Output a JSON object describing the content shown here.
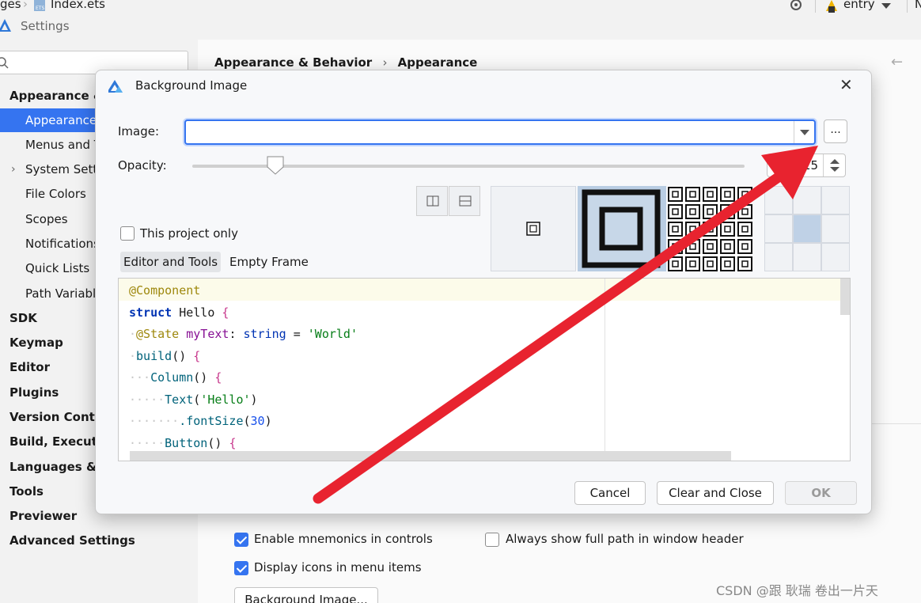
{
  "topbar": {
    "breadcrumb_left": "ges",
    "file_name": "Index.ets",
    "run_config": "entry",
    "overflow_char": "N"
  },
  "window": {
    "title": "Settings"
  },
  "sidebar": {
    "search_placeholder": "",
    "items": [
      {
        "label": "Appearance & Behavior",
        "level": 0
      },
      {
        "label": "Appearance",
        "level": 1,
        "selected": true
      },
      {
        "label": "Menus and Toolbars",
        "level": 1
      },
      {
        "label": "System Settings",
        "level": 1,
        "expandable": true
      },
      {
        "label": "File Colors",
        "level": 1
      },
      {
        "label": "Scopes",
        "level": 1
      },
      {
        "label": "Notifications",
        "level": 1
      },
      {
        "label": "Quick Lists",
        "level": 1
      },
      {
        "label": "Path Variables",
        "level": 1
      },
      {
        "label": "SDK",
        "level": 0
      },
      {
        "label": "Keymap",
        "level": 0
      },
      {
        "label": "Editor",
        "level": 0
      },
      {
        "label": "Plugins",
        "level": 0
      },
      {
        "label": "Version Control",
        "level": 0
      },
      {
        "label": "Build, Execution, Deployment",
        "level": 0
      },
      {
        "label": "Languages & Frameworks",
        "level": 0
      },
      {
        "label": "Tools",
        "level": 0
      },
      {
        "label": "Previewer",
        "level": 0
      },
      {
        "label": "Advanced Settings",
        "level": 0
      }
    ]
  },
  "content": {
    "breadcrumb_parent": "Appearance & Behavior",
    "breadcrumb_sep": "›",
    "breadcrumb_current": "Appearance",
    "options": [
      {
        "label": "Enable mnemonics in controls",
        "checked": true
      },
      {
        "label": "Display icons in menu items",
        "checked": true
      },
      {
        "label": "Always show full path in window header",
        "checked": false
      }
    ],
    "background_image_button": "Background Image..."
  },
  "dialog": {
    "title": "Background Image",
    "close_glyph": "✕",
    "image_label": "Image:",
    "image_value": "",
    "browse_label": "...",
    "opacity_label": "Opacity:",
    "opacity_value": 15,
    "opacity_display": "15",
    "this_project_only_label": "This project only",
    "this_project_only_checked": false,
    "tabs": [
      "Editor and Tools",
      "Empty Frame"
    ],
    "active_tab": "Editor and Tools",
    "fill_modes": [
      "plain",
      "scale",
      "tile"
    ],
    "selected_fill_mode": "scale",
    "anchor_selected": "center",
    "code_lines": [
      [
        {
          "t": "@Component",
          "c": "c-ann"
        }
      ],
      [
        {
          "t": "struct",
          "c": "c-kw"
        },
        {
          "t": " Hello ",
          "c": "c-plain"
        },
        {
          "t": "{",
          "c": "c-brace"
        }
      ],
      [
        {
          "t": "·",
          "c": "c-ws"
        },
        {
          "t": "@State",
          "c": "c-ann"
        },
        {
          "t": " myText",
          "c": "c-kw2"
        },
        {
          "t": ": ",
          "c": "c-plain"
        },
        {
          "t": "string",
          "c": "c-type"
        },
        {
          "t": " = ",
          "c": "c-plain"
        },
        {
          "t": "'World'",
          "c": "c-str"
        }
      ],
      [
        {
          "t": "·",
          "c": "c-ws"
        },
        {
          "t": "build",
          "c": "c-fn"
        },
        {
          "t": "() ",
          "c": "c-plain"
        },
        {
          "t": "{",
          "c": "c-brace"
        }
      ],
      [
        {
          "t": "···",
          "c": "c-ws"
        },
        {
          "t": "Column",
          "c": "c-fn"
        },
        {
          "t": "() ",
          "c": "c-plain"
        },
        {
          "t": "{",
          "c": "c-brace"
        }
      ],
      [
        {
          "t": "·····",
          "c": "c-ws"
        },
        {
          "t": "Text",
          "c": "c-fn"
        },
        {
          "t": "(",
          "c": "c-plain"
        },
        {
          "t": "'Hello'",
          "c": "c-str"
        },
        {
          "t": ")",
          "c": "c-plain"
        }
      ],
      [
        {
          "t": "·······",
          "c": "c-ws"
        },
        {
          "t": ".fontSize",
          "c": "c-fn"
        },
        {
          "t": "(",
          "c": "c-plain"
        },
        {
          "t": "30",
          "c": "c-num"
        },
        {
          "t": ")",
          "c": "c-plain"
        }
      ],
      [
        {
          "t": "·····",
          "c": "c-ws"
        },
        {
          "t": "Button",
          "c": "c-fn"
        },
        {
          "t": "() ",
          "c": "c-plain"
        },
        {
          "t": "{",
          "c": "c-brace"
        }
      ]
    ],
    "buttons": {
      "cancel": "Cancel",
      "clear_and_close": "Clear and Close",
      "ok": "OK"
    }
  },
  "annotation": {
    "arrow_color": "#e8232f"
  },
  "watermark": "CSDN @跟 耿瑞 卷出一片天",
  "colors": {
    "accent": "#3574f0",
    "selection": "#3574f0"
  }
}
